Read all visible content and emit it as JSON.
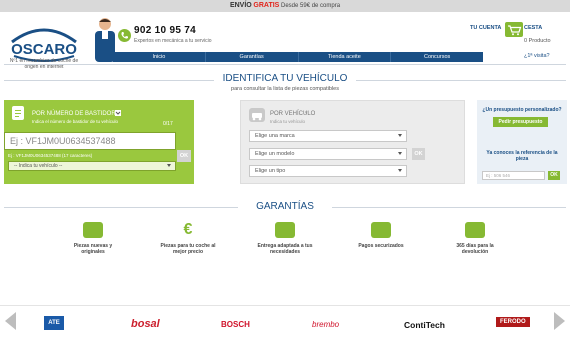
{
  "top_banner": {
    "prefix": "ENVÍO",
    "highlight": "GRATIS",
    "suffix": "Desde 59€ de compra"
  },
  "header": {
    "logo_text": "OSCARO",
    "tagline": "Nº1 en recambios de coche de origen en internet",
    "phone": "902 10 95 74",
    "phone_sub": "Expertos en mecánica a tu servicio",
    "account_label": "TU CUENTA",
    "cart_label": "CESTA",
    "cart_count": "0 Producto",
    "first_visit": "¿1ª visita?"
  },
  "nav": {
    "items": [
      "Inicio",
      "Garantías",
      "Tienda aceite",
      "Concursos"
    ]
  },
  "identify": {
    "title": "IDENTIFICA TU VEHÍCULO",
    "subtitle": "para consultar la lista de piezas compatibles"
  },
  "vin_panel": {
    "title": "POR NÚMERO DE BASTIDOR",
    "subtitle": "Indica el número de bastidor de tu vehículo",
    "counter": "0/17",
    "placeholder": "Ej : VF1JM0U0634537488",
    "help": "Ej : VF1JM0U0634537488 (17 caracteres)",
    "select": "-- Indica tu vehículo --",
    "ok": "OK"
  },
  "vehicle_panel": {
    "title": "POR VEHÍCULO",
    "subtitle": "Indica tu vehículo",
    "brand_select": "Elige una marca",
    "model_select": "Elige un modelo",
    "type_select": "Elige un tipo",
    "ok": "OK"
  },
  "side_panel": {
    "question": "¿Un presupuesto personalizado?",
    "button": "Pedir presupuesto",
    "ref_text": "Ya conoces la referencia de la pieza",
    "ref_placeholder": "Ej : 506 546",
    "ok": "OK"
  },
  "guarantees": {
    "title": "GARANTÍAS",
    "items": [
      {
        "label": "Piezas nuevas y originales",
        "icon": "box-icon"
      },
      {
        "label": "Piezas para tu coche al mejor precio",
        "icon": "euro-icon"
      },
      {
        "label": "Entrega adaptada a tus necesidades",
        "icon": "truck-icon"
      },
      {
        "label": "Pagos securizados",
        "icon": "credit-card-icon"
      },
      {
        "label": "365 días para la devolución",
        "icon": "return-box-icon"
      }
    ]
  },
  "brands": {
    "names": [
      "ATE",
      "bosal",
      "BOSCH",
      "brembo",
      "ContiTech",
      "FERODO"
    ]
  },
  "colors": {
    "brand_blue": "#1a4f85",
    "green": "#86b933",
    "panel_green": "#9ac83e",
    "red": "#e2241b"
  }
}
